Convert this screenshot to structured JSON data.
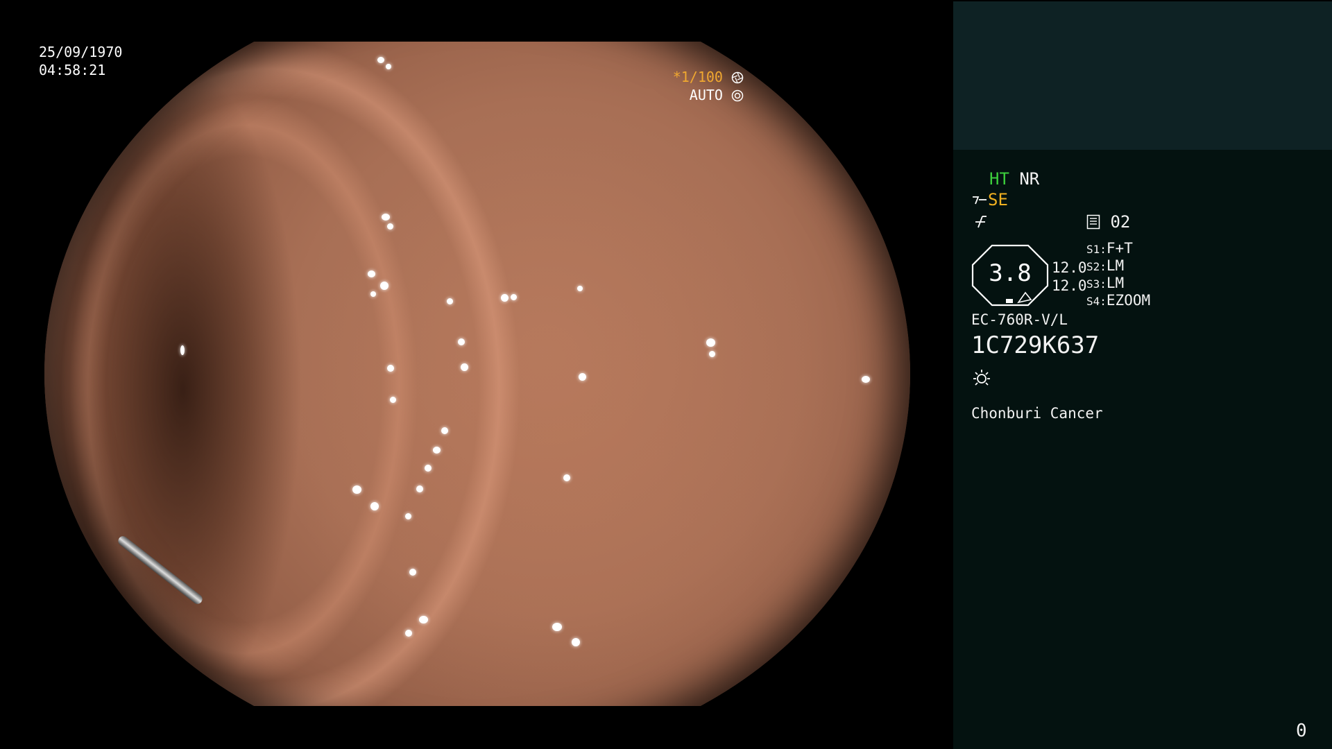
{
  "overlay": {
    "date": "25/09/1970",
    "time": "04:58:21",
    "shutter_speed": "*1/100",
    "exposure_mode": "AUTO"
  },
  "panel": {
    "ht_label": "HT",
    "nr_label": "NR",
    "se_label": "SE",
    "page_number": "02",
    "zoom_value": "3.8",
    "side_value_1": "12.0",
    "side_value_2": "12.0",
    "scope_slots": [
      {
        "key": "S1",
        "value": "F+T"
      },
      {
        "key": "S2",
        "value": "LM"
      },
      {
        "key": "S3",
        "value": "LM"
      },
      {
        "key": "S4",
        "value": "EZOOM"
      }
    ],
    "scope_model": "EC-760R-V/L",
    "scope_serial": "1C729K637",
    "institution": "Chonburi Cancer",
    "counter": "0"
  },
  "icons": {
    "shutter": "aperture-icon",
    "auto": "iris-icon",
    "se": "enhancement-icon",
    "structure": "sharpness-icon",
    "page": "memory-card-icon",
    "light": "sun-icon"
  },
  "colors": {
    "ht": "#3ccf3c",
    "se": "#f0b020",
    "shutter": "#f0a830",
    "panel_bg": "#041210",
    "panel_top_bg": "#0e2224"
  }
}
